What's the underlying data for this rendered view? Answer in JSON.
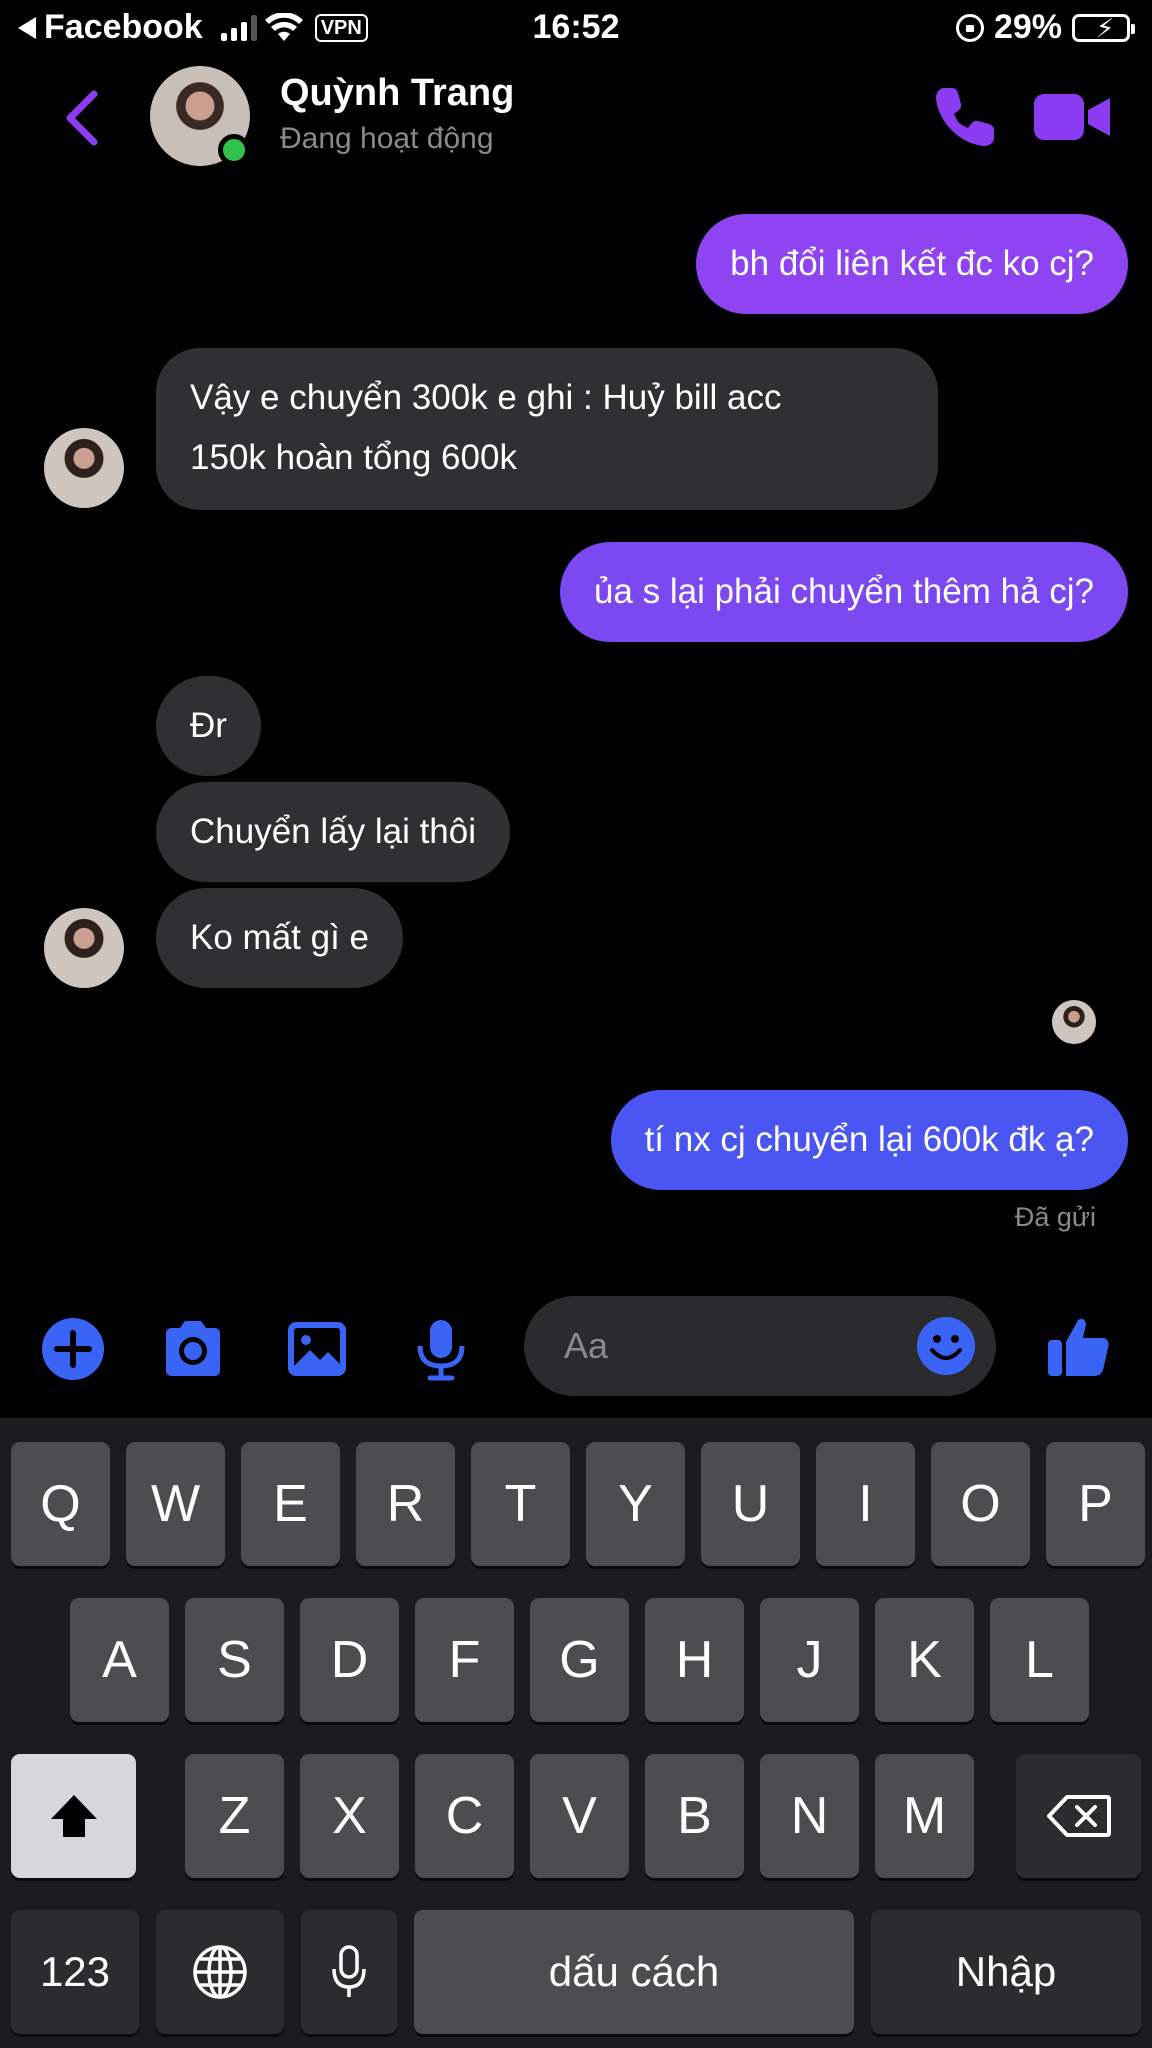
{
  "status_bar": {
    "back_app": "Facebook",
    "vpn": "VPN",
    "time": "16:52",
    "battery": "29%",
    "battery_level": 0.29
  },
  "header": {
    "name": "Quỳnh Trang",
    "status": "Đang hoạt động",
    "accent": "#8b3cf3"
  },
  "messages": [
    {
      "from": "me",
      "text": "bh đổi liên kết đc ko cj?"
    },
    {
      "from": "them",
      "lines": [
        "Vậy e chuyển 300k e ghi : Huỷ bill acc",
        "150k hoàn tổng 600k"
      ]
    },
    {
      "from": "me",
      "text": "ủa s lại phải chuyển thêm hả cj?"
    },
    {
      "from": "them",
      "text": "Đr"
    },
    {
      "from": "them",
      "text": "Chuyển lấy lại thôi"
    },
    {
      "from": "them",
      "text": "Ko mất gì e"
    },
    {
      "from": "me",
      "text": "tí nx cj chuyển lại 600k đk ạ?"
    }
  ],
  "delivered": "Đã gửi",
  "composer": {
    "placeholder": "Aa",
    "icons": [
      "plus-icon",
      "camera-icon",
      "image-icon",
      "microphone-icon",
      "emoji-icon",
      "like-icon"
    ],
    "icon_color": "#3a64f5"
  },
  "keyboard": {
    "row1": [
      "Q",
      "W",
      "E",
      "R",
      "T",
      "Y",
      "U",
      "I",
      "O",
      "P"
    ],
    "row2": [
      "A",
      "S",
      "D",
      "F",
      "G",
      "H",
      "J",
      "K",
      "L"
    ],
    "row3": [
      "Z",
      "X",
      "C",
      "V",
      "B",
      "N",
      "M"
    ],
    "numbers": "123",
    "space": "dấu cách",
    "return": "Nhập"
  }
}
